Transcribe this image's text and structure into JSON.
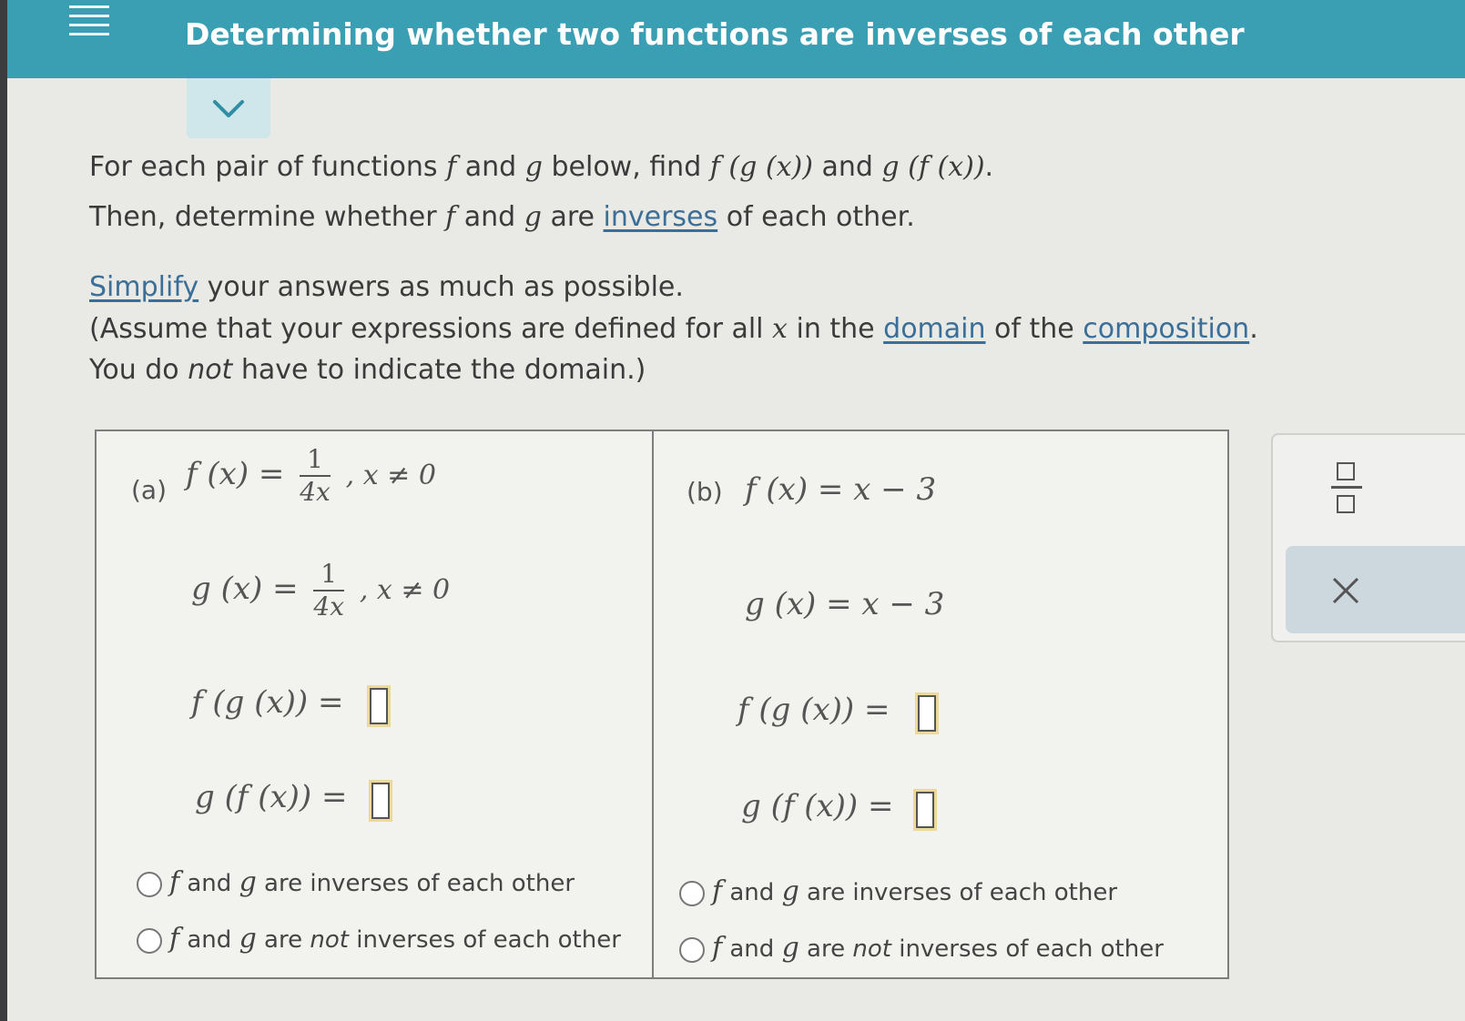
{
  "header": {
    "title": "Determining whether two functions are inverses of each other"
  },
  "instructions": {
    "line1": {
      "pre": "For each pair of functions ",
      "f": "f",
      "mid1": " and ",
      "g": "g",
      "mid2": " below, find ",
      "fgx": "f (g (x))",
      "and": " and ",
      "gfx": "g (f (x))",
      "end": "."
    },
    "line2": {
      "pre": "Then, determine whether ",
      "f": "f",
      "mid1": " and ",
      "g": "g",
      "mid2": " are ",
      "link": "inverses",
      "end": " of each other."
    },
    "line3": {
      "link": "Simplify",
      "rest": " your answers as much as possible."
    },
    "line4": {
      "pre": "(Assume that your expressions are defined for all ",
      "x": "x",
      "mid": " in the ",
      "link1": "domain",
      "mid2": " of the ",
      "link2": "composition",
      "end": "."
    },
    "line5": {
      "pre": "You do ",
      "em": "not",
      "end": " have to indicate the domain.)"
    }
  },
  "part_a": {
    "label": "(a)",
    "f_lhs": "f (x) =",
    "f_num": "1",
    "f_den": "4x",
    "f_cond": ",  x ≠ 0",
    "g_lhs": "g (x) =",
    "g_num": "1",
    "g_den": "4x",
    "g_cond": ",  x ≠ 0",
    "fg_lhs": "f (g (x)) =",
    "gf_lhs": "g (f (x)) =",
    "opt1": {
      "f": "f",
      "mid": " and ",
      "g": "g",
      "rest": " are inverses of each other"
    },
    "opt2": {
      "f": "f",
      "mid": " and ",
      "g": "g",
      "pre": " are ",
      "em": "not",
      "rest": " inverses of each other"
    }
  },
  "part_b": {
    "label": "(b)",
    "f_def": "f (x) = x − 3",
    "g_def": "g (x) = x − 3",
    "fg_lhs": "f (g (x)) =",
    "gf_lhs": "g (f (x)) =",
    "opt1": {
      "f": "f",
      "mid": " and ",
      "g": "g",
      "rest": " are inverses of each other"
    },
    "opt2": {
      "f": "f",
      "mid": " and ",
      "g": "g",
      "pre": " are ",
      "em": "not",
      "rest": " inverses of each other"
    }
  },
  "toolbox": {
    "fraction_icon": "fraction-icon",
    "clear_icon": "close-icon"
  },
  "colors": {
    "header": "#3a9fb3",
    "link": "#3b6f98",
    "chevron_tab": "#cfe6ea",
    "clear_button": "#ccd8de"
  }
}
